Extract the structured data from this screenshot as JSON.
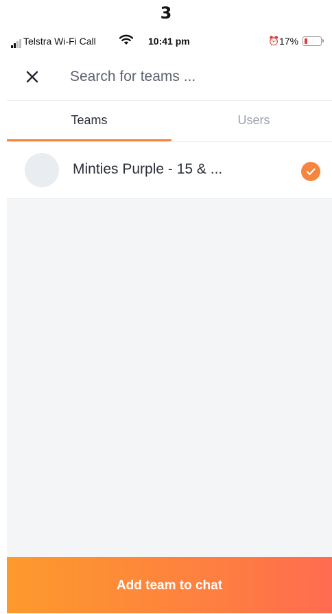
{
  "step_number": "3",
  "status_bar": {
    "carrier": "Telstra Wi-Fi Call",
    "time": "10:41 pm",
    "battery_percent": "17%",
    "battery_level": 0.17,
    "signal_bars_active": 2,
    "signal_bars_total": 4,
    "icons": [
      "signal-icon",
      "wifi-icon",
      "alarm-icon",
      "battery-icon"
    ]
  },
  "search": {
    "placeholder": "Search for teams ...",
    "value": ""
  },
  "tabs": [
    {
      "label": "Teams",
      "active": true
    },
    {
      "label": "Users",
      "active": false
    }
  ],
  "teams": [
    {
      "name": "Minties Purple - 15 & ...",
      "selected": true
    }
  ],
  "action_button": {
    "label": "Add team to chat"
  },
  "colors": {
    "accent": "#f7823c",
    "button_gradient_start": "#fd9a2c",
    "button_gradient_end": "#ff6b50",
    "battery_low": "#e53935"
  }
}
